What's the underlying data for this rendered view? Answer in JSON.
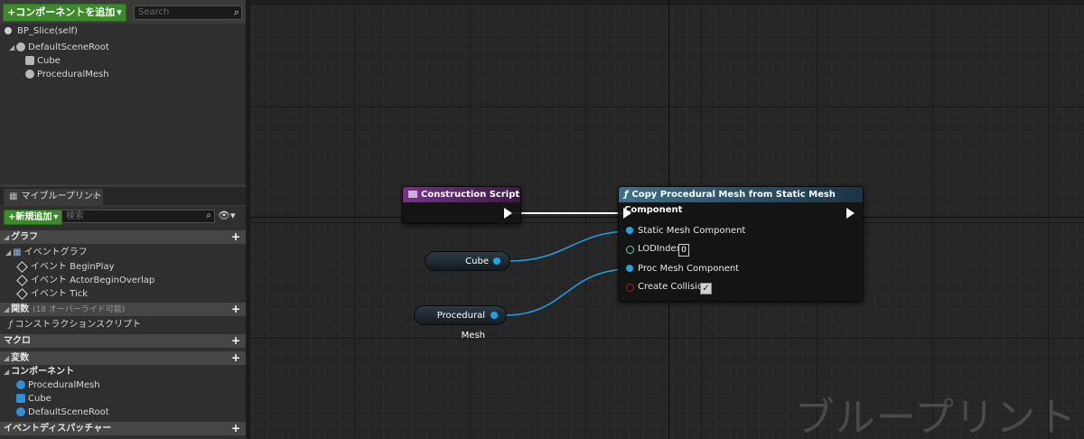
{
  "components_panel": {
    "add_button": "+コンポーネントを追加",
    "search_placeholder": "Search",
    "self_label": "BP_Slice(self)",
    "tree": [
      {
        "label": "DefaultSceneRoot"
      },
      {
        "label": "Cube"
      },
      {
        "label": "ProceduralMesh"
      }
    ]
  },
  "my_blueprint": {
    "tab_label": "マイブループリント",
    "add_button": "+新規追加",
    "search_placeholder": "検索",
    "categories": {
      "graph": "グラフ",
      "functions": "関数",
      "functions_sub": "(18 オーバーライド可能)",
      "macros": "マクロ",
      "variables": "変数",
      "components": "コンポーネント",
      "dispatchers": "イベントディスパッチャー"
    },
    "event_graph": "イベントグラフ",
    "events": [
      "イベント BeginPlay",
      "イベント ActorBeginOverlap",
      "イベント Tick"
    ],
    "construction_script": "コンストラクションスクリプト",
    "component_items": [
      "ProceduralMesh",
      "Cube",
      "DefaultSceneRoot"
    ]
  },
  "graph": {
    "watermark": "ブループリント",
    "construction_node": {
      "title": "Construction Script",
      "color": "#6a2d7a"
    },
    "copy_node": {
      "title": "Copy Procedural Mesh from Static Mesh Component",
      "color": "#2f5e78",
      "pins": {
        "static_mesh": "Static Mesh Component",
        "lod": "LODIndex",
        "lod_value": "0",
        "proc_mesh": "Proc Mesh Component",
        "collision": "Create Collision"
      },
      "create_collision_checked": true
    },
    "cube_node": {
      "label": "Cube"
    },
    "procmesh_node": {
      "label": "Procedural Mesh"
    }
  }
}
